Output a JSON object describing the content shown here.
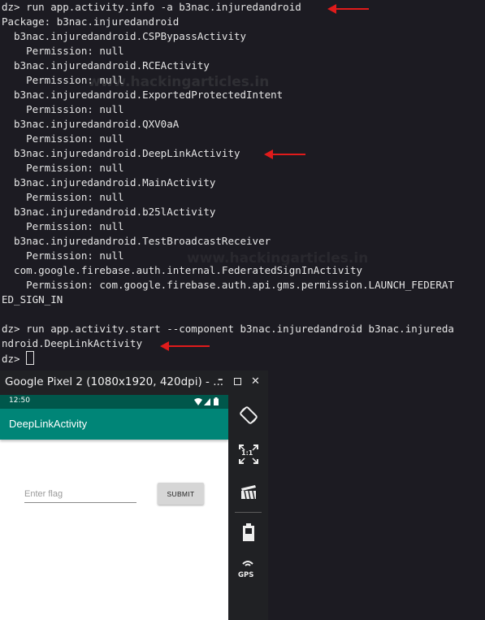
{
  "terminal": {
    "lines": [
      "dz> run app.activity.info -a b3nac.injuredandroid",
      "Package: b3nac.injuredandroid",
      "  b3nac.injuredandroid.CSPBypassActivity",
      "    Permission: null",
      "  b3nac.injuredandroid.RCEActivity",
      "    Permission: null",
      "  b3nac.injuredandroid.ExportedProtectedIntent",
      "    Permission: null",
      "  b3nac.injuredandroid.QXV0aA",
      "    Permission: null",
      "  b3nac.injuredandroid.DeepLinkActivity",
      "    Permission: null",
      "  b3nac.injuredandroid.MainActivity",
      "    Permission: null",
      "  b3nac.injuredandroid.b25lActivity",
      "    Permission: null",
      "  b3nac.injuredandroid.TestBroadcastReceiver",
      "    Permission: null",
      "  com.google.firebase.auth.internal.FederatedSignInActivity",
      "    Permission: com.google.firebase.auth.api.gms.permission.LAUNCH_FEDERAT",
      "ED_SIGN_IN",
      "",
      "dz> run app.activity.start --component b3nac.injuredandroid b3nac.injureda",
      "ndroid.DeepLinkActivity"
    ],
    "prompt": "dz> ",
    "watermark": "www.hackingarticles.in"
  },
  "emulator": {
    "window_title": "Google Pixel 2 (1080x1920, 420dpi) - ...",
    "minimize_icon": "minimize-icon",
    "maximize_icon": "maximize-icon",
    "close_label": "✕",
    "status_time": "12:50",
    "app_title": "DeepLinkActivity",
    "flag_placeholder": "Enter flag",
    "submit_label": "SUBMIT",
    "side_buttons": [
      "rotate-icon",
      "fullscreen-icon",
      "screen-record-icon",
      "battery-icon",
      "gps-icon"
    ],
    "fullscreen_label": "1:1",
    "gps_label": "GPS"
  },
  "colors": {
    "terminal_bg": "#1c1b22",
    "arrow": "#e01b1b",
    "status_bar": "#00574b",
    "app_bar": "#008577"
  }
}
